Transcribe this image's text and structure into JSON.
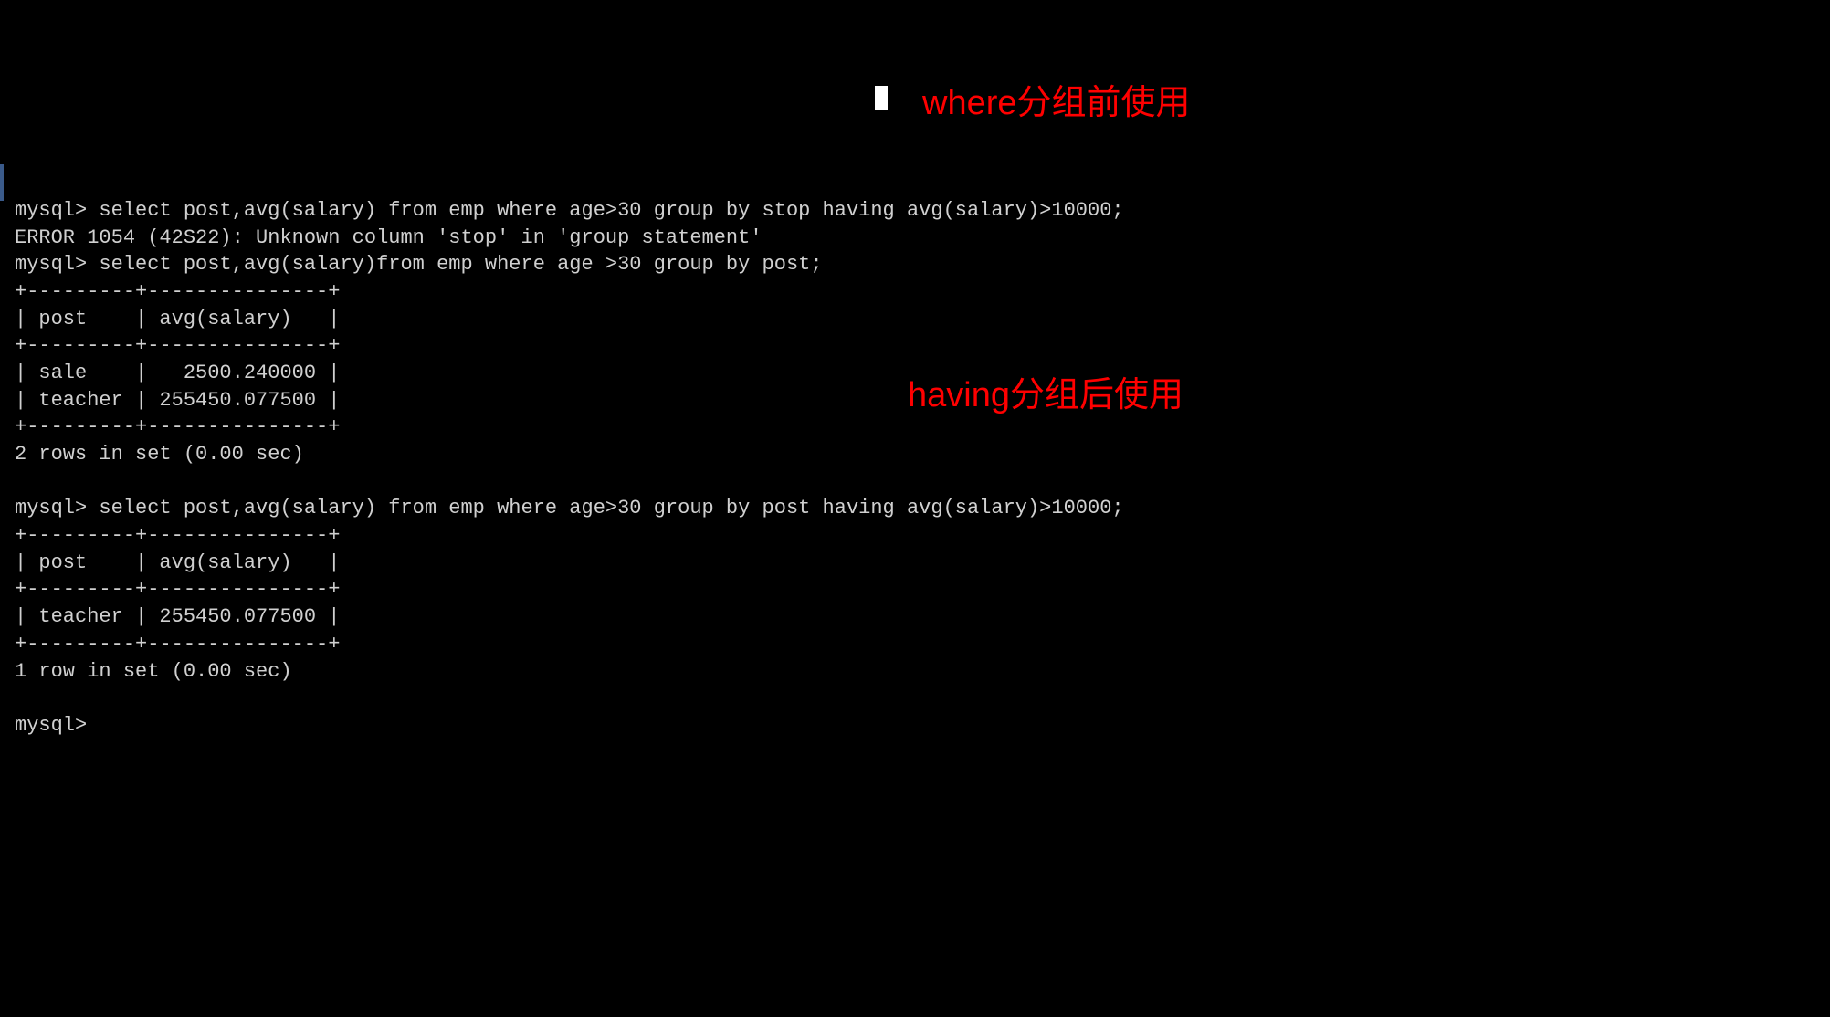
{
  "terminal": {
    "line1": "mysql> select post,avg(salary) from emp where age>30 group by stop having avg(salary)>10000;",
    "line2": "ERROR 1054 (42S22): Unknown column 'stop' in 'group statement'",
    "line3": "mysql> select post,avg(salary)from emp where age >30 group by post;",
    "table1_border": "+---------+---------------+",
    "table1_header": "| post    | avg(salary)   |",
    "table1_row1": "| sale    |   2500.240000 |",
    "table1_row2": "| teacher | 255450.077500 |",
    "table1_result": "2 rows in set (0.00 sec)",
    "blank": "",
    "line4": "mysql> select post,avg(salary) from emp where age>30 group by post having avg(salary)>10000;",
    "table2_border": "+---------+---------------+",
    "table2_header": "| post    | avg(salary)   |",
    "table2_row1": "| teacher | 255450.077500 |",
    "table2_result": "1 row in set (0.00 sec)",
    "prompt": "mysql>"
  },
  "annotations": {
    "where_note": "where分组前使用",
    "having_note": "having分组后使用"
  },
  "chart_data": {
    "type": "table",
    "queries": [
      {
        "sql": "select post,avg(salary) from emp where age>30 group by stop having avg(salary)>10000;",
        "error": "ERROR 1054 (42S22): Unknown column 'stop' in 'group statement'"
      },
      {
        "sql": "select post,avg(salary)from emp where age >30 group by post;",
        "columns": [
          "post",
          "avg(salary)"
        ],
        "rows": [
          {
            "post": "sale",
            "avg(salary)": 2500.24
          },
          {
            "post": "teacher",
            "avg(salary)": 255450.0775
          }
        ],
        "result_summary": "2 rows in set (0.00 sec)"
      },
      {
        "sql": "select post,avg(salary) from emp where age>30 group by post having avg(salary)>10000;",
        "columns": [
          "post",
          "avg(salary)"
        ],
        "rows": [
          {
            "post": "teacher",
            "avg(salary)": 255450.0775
          }
        ],
        "result_summary": "1 row in set (0.00 sec)"
      }
    ]
  }
}
